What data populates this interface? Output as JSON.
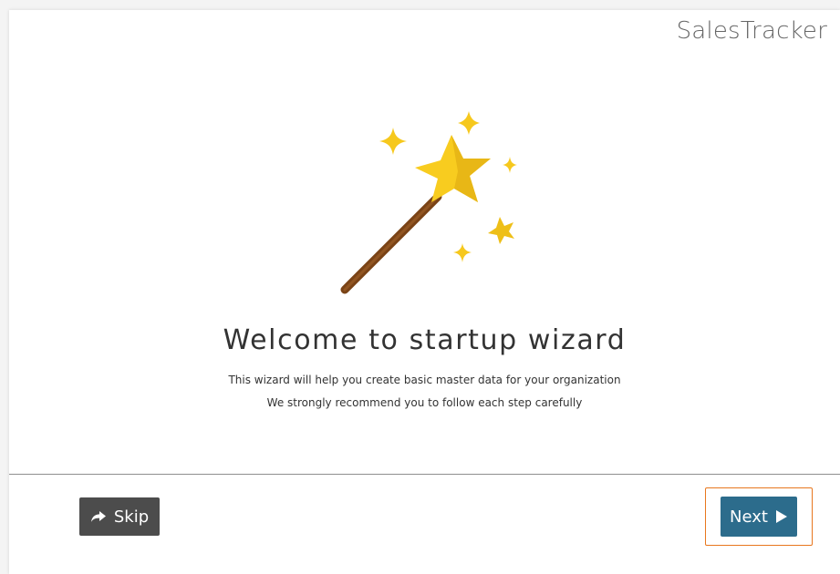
{
  "app": {
    "brand_name": "SalesTracker"
  },
  "wizard": {
    "title": "Welcome to startup wizard",
    "description_line_1": "This wizard will help you create basic master data for your organization",
    "description_line_2": "We strongly recommend you to follow each step carefully",
    "illustration_icon": "magic-wand-icon"
  },
  "footer": {
    "skip_label": "Skip",
    "skip_icon": "share-arrow-icon",
    "next_label": "Next",
    "next_icon": "play-triangle-icon"
  },
  "colors": {
    "skip_button_bg": "#4c4c4c",
    "next_button_bg": "#2c6c8c",
    "focus_ring": "#e8771e",
    "star_primary": "#f6c81d",
    "star_shadow": "#e9b916",
    "wand_handle": "#8b4e1d"
  }
}
